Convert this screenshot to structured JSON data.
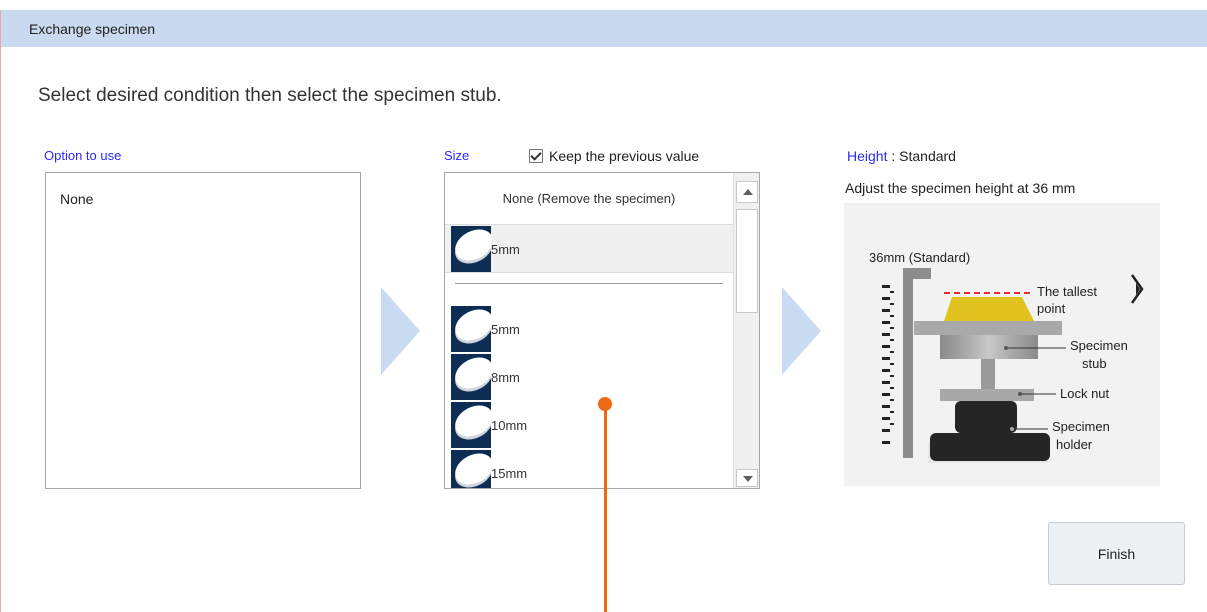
{
  "window": {
    "title": "Exchange specimen"
  },
  "instruction": "Select desired condition then select the specimen stub.",
  "option": {
    "label": "Option to use",
    "items": [
      "None"
    ]
  },
  "size": {
    "label": "Size",
    "keep_previous": {
      "label": "Keep the previous value",
      "checked": true
    },
    "none_item": "None (Remove the specimen)",
    "selected": "5mm",
    "items": [
      "5mm",
      "8mm",
      "10mm",
      "15mm"
    ]
  },
  "height": {
    "key": "Height",
    "value": ": Standard",
    "adjust_text": "Adjust the specimen height at 36 mm"
  },
  "diagram": {
    "standard_label": "36mm (Standard)",
    "tallest_line1": "The tallest",
    "tallest_line2": "point",
    "stub_line1": "Specimen",
    "stub_line2": "stub",
    "lock_nut": "Lock nut",
    "holder_line1": "Specimen",
    "holder_line2": "holder"
  },
  "finish_label": "Finish",
  "colors": {
    "titlebar": "#c9d9ef",
    "label_blue": "#2b2bf5",
    "arrow": "#c9dbf1",
    "pointer": "#ee6a12"
  }
}
